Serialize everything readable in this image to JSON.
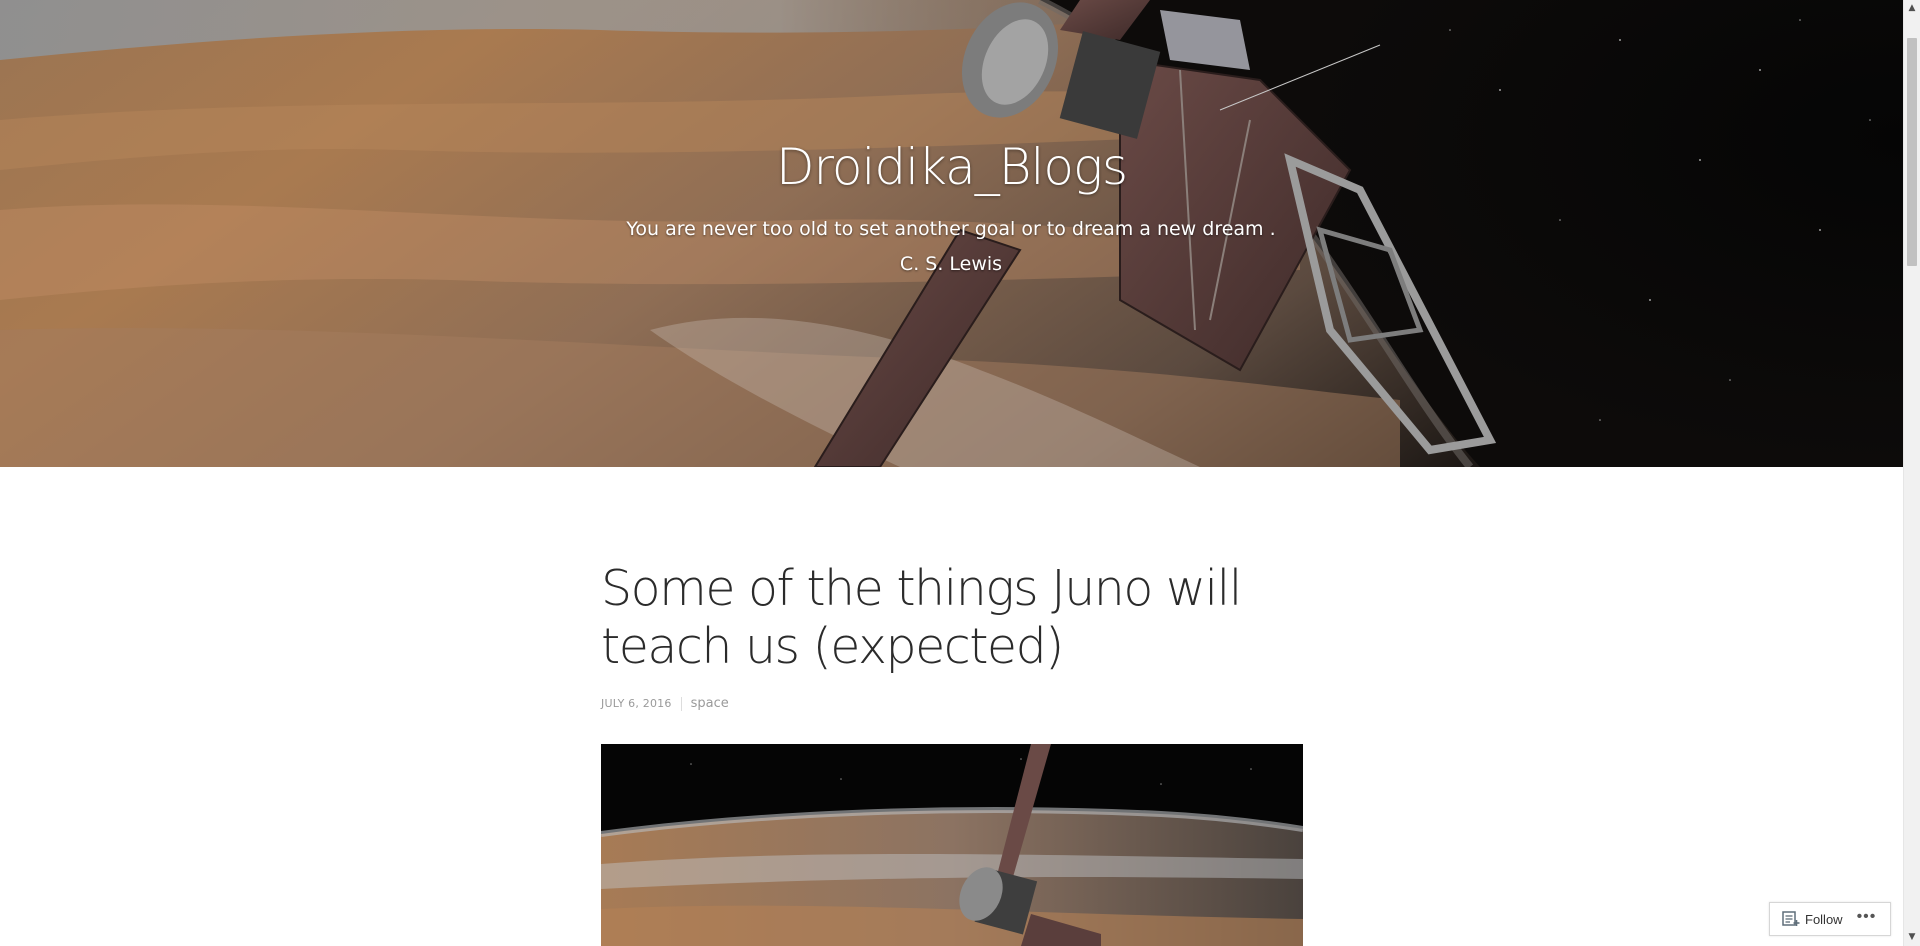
{
  "header": {
    "site_title": "Droidika_Blogs",
    "site_description": "You are never too old to set another goal or to dream a new dream . C. S. Lewis"
  },
  "post": {
    "title": "Some of the things Juno will teach us (expected)",
    "date": "JULY 6, 2016",
    "category": "space"
  },
  "follow_widget": {
    "follow_label": "Follow",
    "more_label": "•••"
  },
  "scrollbar": {
    "up_arrow": "▲",
    "down_arrow": "▼"
  }
}
